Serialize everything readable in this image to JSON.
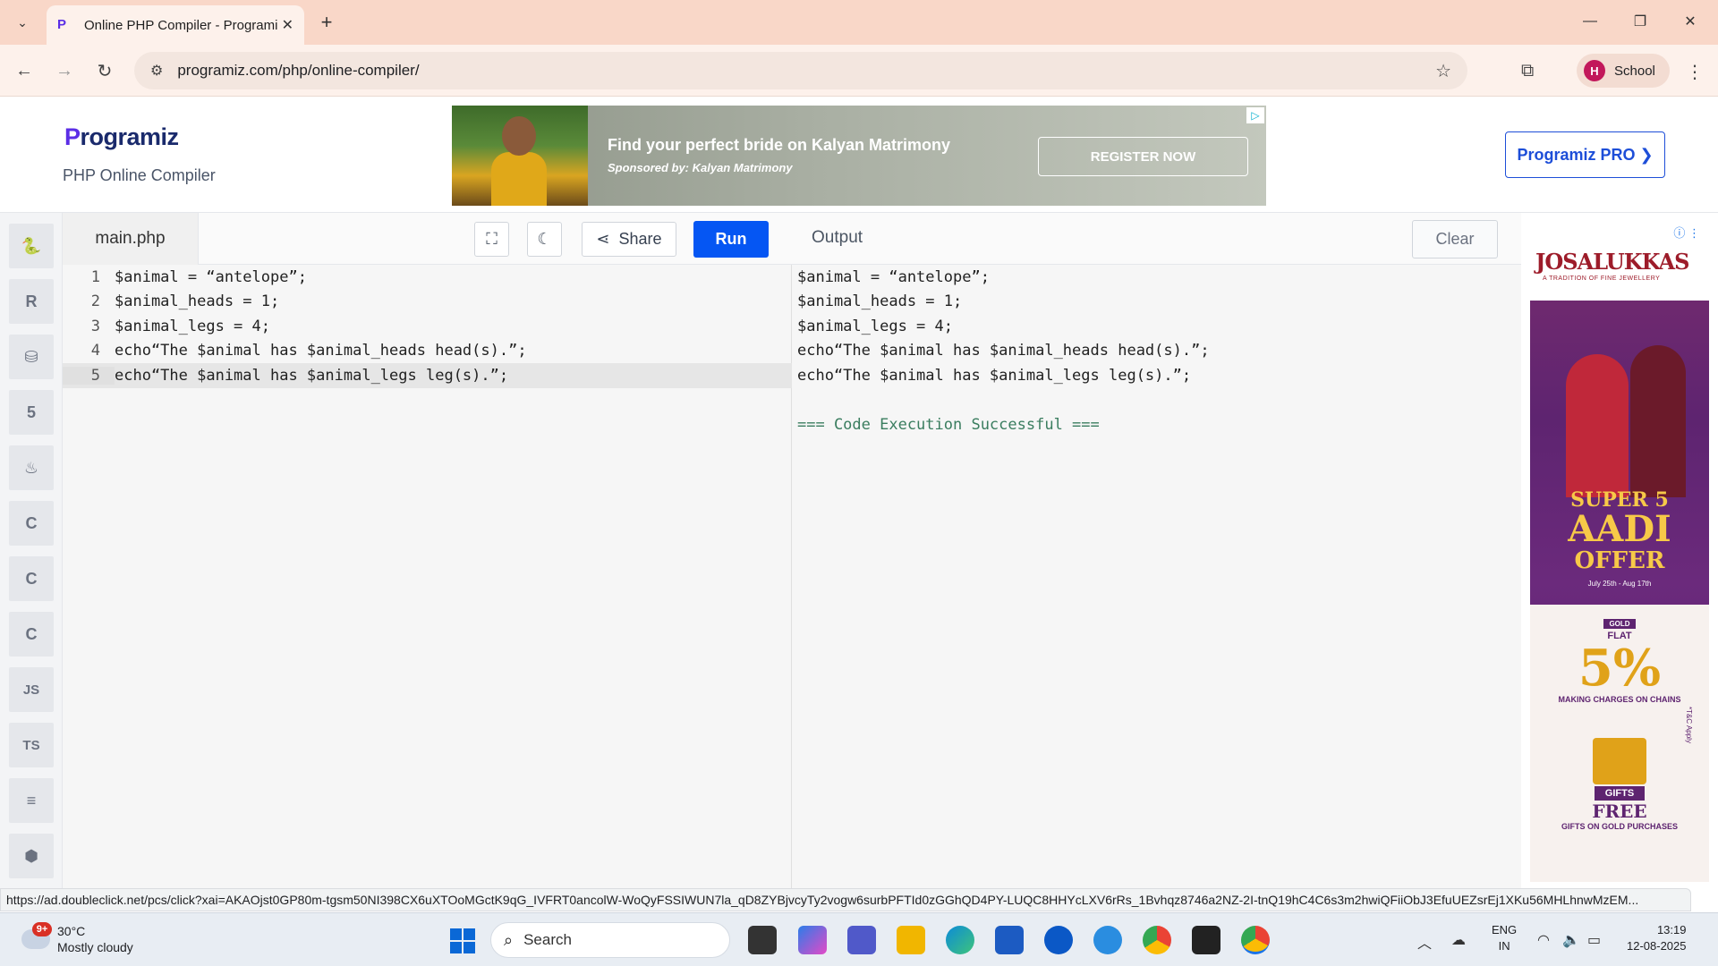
{
  "browser": {
    "tab_title": "Online PHP Compiler - Programiz",
    "url": "programiz.com/php/online-compiler/",
    "profile_initial": "H",
    "profile_name": "School"
  },
  "header": {
    "logo_text": "rogramiz",
    "logo_letter": "P",
    "subtitle": "PHP Online Compiler",
    "pro_button": "Programiz PRO ❯"
  },
  "banner_ad": {
    "headline": "Find your perfect bride on Kalyan Matrimony",
    "sponsor": "Sponsored by: Kalyan Matrimony",
    "cta": "REGISTER NOW"
  },
  "languages": [
    {
      "name": "python-icon",
      "glyph": "🐍"
    },
    {
      "name": "r-icon",
      "glyph": "R"
    },
    {
      "name": "sql-icon",
      "glyph": "⛁"
    },
    {
      "name": "html-icon",
      "glyph": "5"
    },
    {
      "name": "java-icon",
      "glyph": "♨"
    },
    {
      "name": "c-icon",
      "glyph": "C"
    },
    {
      "name": "cpp-icon",
      "glyph": "C"
    },
    {
      "name": "csharp-icon",
      "glyph": "C"
    },
    {
      "name": "js-icon",
      "glyph": "JS"
    },
    {
      "name": "ts-icon",
      "glyph": "TS"
    },
    {
      "name": "go-icon",
      "glyph": "≡"
    },
    {
      "name": "php-icon",
      "glyph": "⬢"
    }
  ],
  "editor": {
    "filename": "main.php",
    "share_label": "Share",
    "run_label": "Run",
    "lines": [
      {
        "n": "1",
        "code": "$animal = “antelope”;"
      },
      {
        "n": "2",
        "code": "$animal_heads = 1;"
      },
      {
        "n": "3",
        "code": "$animal_legs = 4;"
      },
      {
        "n": "4",
        "code": "echo“The $animal has $animal_heads head(s).”;"
      },
      {
        "n": "5",
        "code": "echo“The $animal has $animal_legs leg(s).”;"
      }
    ],
    "active_line": 5
  },
  "output": {
    "title": "Output",
    "clear_label": "Clear",
    "lines": [
      "$animal = “antelope”;",
      "$animal_heads = 1;",
      "$animal_legs = 4;",
      "echo“The $animal has $animal_heads head(s).”;",
      "echo“The $animal has $animal_legs leg(s).”;"
    ],
    "success": "=== Code Execution Successful ==="
  },
  "side_ad": {
    "brand": "JOSALUKKAS",
    "tagline": "A TRADITION OF FINE JEWELLERY",
    "super": "SUPER 5",
    "aadi": "AADI",
    "offer": "OFFER",
    "dates": "July 25th - Aug 17th",
    "gold": "GOLD",
    "flat": "FLAT",
    "percent": "5%",
    "making": "MAKING CHARGES ON CHAINS",
    "gifts": "GIFTS",
    "free": "FREE",
    "gifts_on": "GIFTS ON GOLD PURCHASES",
    "tc": "*T&C Apply"
  },
  "status_url": "https://ad.doubleclick.net/pcs/click?xai=AKAOjst0GP80m-tgsm50NI398CX6uXTOoMGctK9qG_IVFRT0ancolW-WoQyFSSIWUN7la_qD8ZYBjvcyTy2vogw6surbPFTId0zGGhQD4PY-LUQC8HHYcLXV6rRs_1Bvhqz8746a2NZ-2I-tnQ19hC4C6s3m2hwiQFiiObJ3EfuUEZsrEj1XKu56MHLhnwMzEM...",
  "taskbar": {
    "weather_badge": "9+",
    "temperature": "30°C",
    "condition": "Mostly cloudy",
    "search_label": "Search",
    "lang_top": "ENG",
    "lang_bottom": "IN",
    "time": "13:19",
    "date": "12-08-2025"
  }
}
